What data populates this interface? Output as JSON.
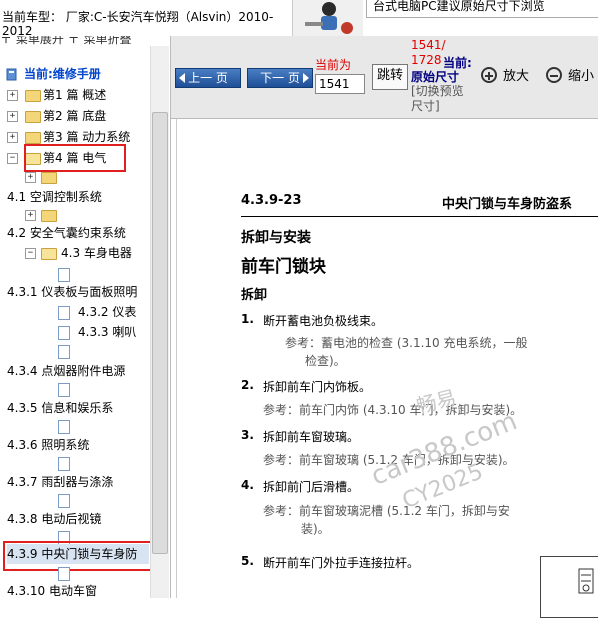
{
  "banner": {
    "vehicle": "当前车型：  厂家:C-长安汽车悦翔（Alsvin）2010-2012",
    "tip": "台式电脑PC建议原始尺寸下浏览"
  },
  "tree": {
    "toolbar": "〒 菜单展开  〒 菜单折叠",
    "root": "当前:维修手册",
    "items": [
      {
        "label": "第1 篇 概述"
      },
      {
        "label": "第2 篇 底盘"
      },
      {
        "label": "第3 篇 动力系统"
      },
      {
        "label": "第4 篇 电气"
      },
      {
        "label": "4.1 空调控制系统"
      },
      {
        "label": "4.2 安全气囊约束系统"
      },
      {
        "label": "4.3 车身电器"
      },
      {
        "label": "4.3.1 仪表板与面板照明"
      },
      {
        "label": "4.3.2 仪表"
      },
      {
        "label": "4.3.3 喇叭"
      },
      {
        "label": "4.3.4 点烟器附件电源"
      },
      {
        "label": "4.3.5 信息和娱乐系"
      },
      {
        "label": "4.3.6 照明系统"
      },
      {
        "label": "4.3.7 雨刮器与涤涤"
      },
      {
        "label": "4.3.8 电动后视镜"
      },
      {
        "label": "4.3.9 中央门锁与车身防"
      },
      {
        "label": "4.3.10 电动车窗"
      }
    ]
  },
  "viewer": {
    "prev": "上一 页",
    "next": "下一 页",
    "page_label": "当前为",
    "page_value": "1541",
    "go": "跳转",
    "page_count": "1541/ 1728",
    "current_label": "当前:",
    "orig_size": "原始尺寸",
    "switch_size": "[切换预览尺寸]",
    "zoom_in": "放大",
    "zoom_out": "缩小"
  },
  "doc": {
    "section": "4.3.9-23",
    "section_title": "中央门锁与车身防盗系",
    "h1": "拆卸与安装",
    "h2": "前车门锁块",
    "h3": "拆卸",
    "steps": [
      {
        "n": "1.",
        "text": "断开蓄电池负极线束。",
        "ref1": "参考：蓄电池的检查 (3.1.10 充电系统，一般",
        "ref2": "检查)。"
      },
      {
        "n": "2.",
        "text": "拆卸前车门内饰板。",
        "ref1": "参考：前车门内饰 (4.3.10 车门，拆卸与安装)。",
        "ref2": ""
      },
      {
        "n": "3.",
        "text": "拆卸前车窗玻璃。",
        "ref1": "参考：前车窗玻璃 (5.1.2 车门，拆卸与安装)。",
        "ref2": ""
      },
      {
        "n": "4.",
        "text": "拆卸前门后滑槽。",
        "ref1": "参考：前车窗玻璃泥槽 (5.1.2 车门，拆卸与安",
        "ref2": "装)。"
      },
      {
        "n": "5.",
        "text": "断开前车门外拉手连接拉杆。",
        "ref1": "",
        "ref2": ""
      }
    ],
    "watermark": [
      "畅易",
      "car388.com",
      "CY2025"
    ]
  }
}
